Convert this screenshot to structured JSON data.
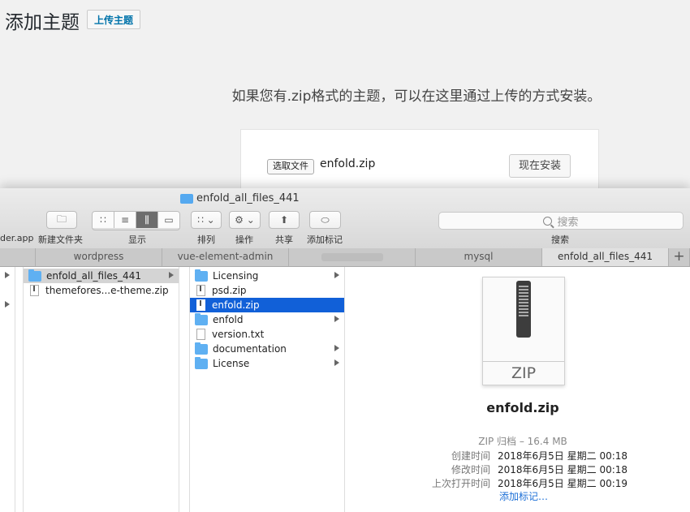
{
  "wordpress": {
    "title": "添加主题",
    "upload_button": "上传主题",
    "description": "如果您有.zip格式的主题，可以在这里通过上传的方式安装。",
    "choose_file_button": "选取文件",
    "chosen_file": "enfold.zip",
    "install_button": "现在安装"
  },
  "finder": {
    "window_title": "enfold_all_files_441",
    "toolbar": {
      "left_cut_label": "der.app",
      "new_folder_label": "新建文件夹",
      "view_label": "显示",
      "arrange_label": "排列",
      "action_label": "操作",
      "share_label": "共享",
      "tag_label": "添加标记",
      "search_placeholder": "搜索",
      "search_label": "搜索"
    },
    "tabs": [
      {
        "label": ""
      },
      {
        "label": "wordpress"
      },
      {
        "label": "vue-element-admin"
      },
      {
        "label": ""
      },
      {
        "label": "mysql"
      },
      {
        "label": "enfold_all_files_441"
      }
    ],
    "column1": [
      {
        "name": "enfold_all_files_441",
        "kind": "folder"
      },
      {
        "name": "themefores...e-theme.zip",
        "kind": "zip"
      }
    ],
    "column2": [
      {
        "name": "Licensing",
        "kind": "folder"
      },
      {
        "name": "psd.zip",
        "kind": "zip"
      },
      {
        "name": "enfold.zip",
        "kind": "zip"
      },
      {
        "name": "enfold",
        "kind": "folder"
      },
      {
        "name": "version.txt",
        "kind": "txt"
      },
      {
        "name": "documentation",
        "kind": "folder"
      },
      {
        "name": "License",
        "kind": "folder"
      }
    ],
    "preview": {
      "icon_label": "ZIP",
      "file_name": "enfold.zip",
      "kind_size": "ZIP 归档 – 16.4 MB",
      "created_key": "创建时间",
      "created": "2018年6月5日 星期二 00:18",
      "modified_key": "修改时间",
      "modified": "2018年6月5日 星期二 00:18",
      "opened_key": "上次打开时间",
      "opened": "2018年6月5日 星期二 00:19",
      "add_tags": "添加标记…"
    }
  },
  "colors": {
    "selection_blue": "#1160d8",
    "folder_blue": "#5fb0f2",
    "wp_link": "#0073aa"
  }
}
